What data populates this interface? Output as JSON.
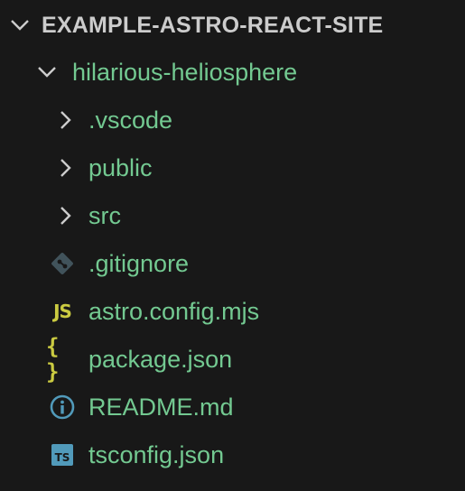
{
  "explorer": {
    "root_title": "EXAMPLE-ASTRO-REACT-SITE",
    "project_folder": "hilarious-heliosphere",
    "folders": [
      {
        "label": ".vscode"
      },
      {
        "label": "public"
      },
      {
        "label": "src"
      }
    ],
    "files": [
      {
        "label": ".gitignore",
        "icon": "git-icon"
      },
      {
        "label": "astro.config.mjs",
        "icon": "javascript-icon",
        "icon_text": "JS"
      },
      {
        "label": "package.json",
        "icon": "json-icon",
        "icon_text": "{ }"
      },
      {
        "label": "README.md",
        "icon": "info-icon"
      },
      {
        "label": "tsconfig.json",
        "icon": "typescript-icon",
        "icon_text": "TS"
      }
    ]
  },
  "colors": {
    "background": "#181818",
    "root_text": "#cccccc",
    "file_text": "#73c991",
    "chevron": "#cccccc",
    "js_yellow": "#cbcb41",
    "git_icon": "#41535b",
    "info_blue": "#519aba",
    "ts_blue": "#519aba"
  }
}
